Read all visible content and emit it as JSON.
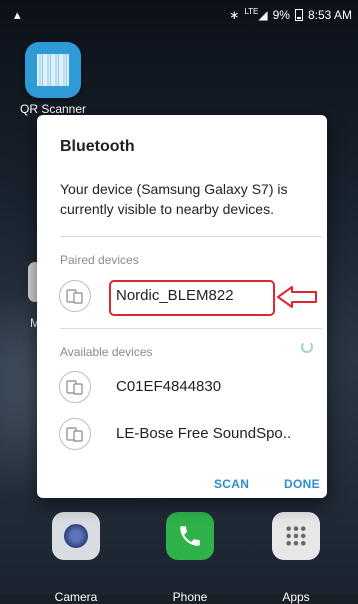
{
  "status_bar": {
    "notification_icon": "ribbon-icon",
    "icons": [
      "bluetooth-icon",
      "lte-signal-icon",
      "battery-icon"
    ],
    "lte_label": "LTE",
    "battery": "9%",
    "time": "8:53 AM"
  },
  "home": {
    "apps": [
      {
        "label": "QR Scanner",
        "icon": "qr-scanner-icon"
      }
    ],
    "partial_label": "M",
    "dock": [
      {
        "label": "Camera",
        "icon": "camera-icon"
      },
      {
        "label": "Phone",
        "icon": "phone-icon"
      },
      {
        "label": "Apps",
        "icon": "apps-grid-icon"
      }
    ]
  },
  "dialog": {
    "title": "Bluetooth",
    "message": "Your device (Samsung Galaxy S7) is currently visible to nearby devices.",
    "paired_label": "Paired devices",
    "paired_devices": [
      "Nordic_BLEM822"
    ],
    "available_label": "Available devices",
    "available_devices": [
      "C01EF4844830",
      "LE-Bose Free SoundSpo.."
    ],
    "scan_label": "SCAN",
    "done_label": "DONE",
    "annotation_color": "#e0262e",
    "accent_color": "#2d8ecf"
  }
}
